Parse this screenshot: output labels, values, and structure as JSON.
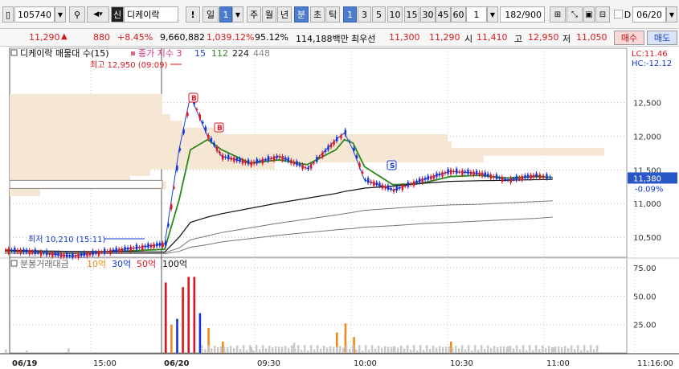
{
  "toolbar": {
    "stock_code": "105740",
    "market_badge": "신",
    "stock_name": "디케이락",
    "period_label": "일",
    "period_value": "1",
    "periods": [
      "주",
      "월",
      "년",
      "분",
      "초",
      "틱"
    ],
    "minute_options": [
      "1",
      "3",
      "5",
      "10",
      "15",
      "30",
      "45",
      "60"
    ],
    "unit_value": "1",
    "count_display": "182/900",
    "date_value": "06/20",
    "exclaim": "!"
  },
  "quote": {
    "price": "11,290",
    "arrow": "▲",
    "change": "880",
    "change_pct": "+8.45%",
    "volume": "9,660,882",
    "volume_ratio": "1,039.12%",
    "strength": "95.12%",
    "amount": "114,188백만",
    "best_label": "최우선",
    "best_ask": "11,300",
    "best_bid": "11,290",
    "open_label": "시",
    "open": "11,410",
    "high_label": "고",
    "high": "12,950",
    "low_label": "저",
    "low": "11,050",
    "buy_label": "매수",
    "sell_label": "매도"
  },
  "chart": {
    "price_panel_title": "디케이락 매물대 수(15)",
    "ma_label": "종가 지수",
    "ma_periods": [
      "3",
      "15",
      "112",
      "224",
      "448"
    ],
    "high_annotation": "최고 12,950 (09:09)",
    "low_annotation": "최저 10,210 (15:11)",
    "lc_label": "LC:11.46",
    "hc_label": "HC:-12.12",
    "current_price_label": "11,380",
    "current_change_label": "-0.09%",
    "signal_b": "B",
    "signal_s": "S",
    "volume_panel_title": "분봉거래대금",
    "volume_levels": [
      "10억",
      "30억",
      "50억",
      "100억"
    ],
    "x_labels": [
      "06/19",
      "15:00",
      "06/20",
      "09:30",
      "10:00",
      "10:30",
      "11:00",
      "11:16:00"
    ],
    "colors": {
      "up": "#e0141e",
      "down": "#1236d6",
      "ma3": "#1e3fd0",
      "ma15": "#2a8a1a",
      "ma112": "#111111",
      "ma224": "#777777",
      "profile": "#f6e6d4",
      "vol_orange": "#f08a1c",
      "vol_gray": "#c8c8c8"
    }
  },
  "chart_data": [
    {
      "type": "line",
      "title": "디케이락 매물대 수(15)",
      "x": [
        "06/19 14:55",
        "06/19 15:00",
        "06/19 15:11",
        "06/20 09:00",
        "06/20 09:05",
        "06/20 09:09",
        "06/20 09:15",
        "06/20 09:20",
        "06/20 09:30",
        "06/20 09:40",
        "06/20 09:50",
        "06/20 10:00",
        "06/20 10:03",
        "06/20 10:06",
        "06/20 10:10",
        "06/20 10:20",
        "06/20 10:30",
        "06/20 10:40",
        "06/20 10:50",
        "06/20 11:00",
        "06/20 11:10",
        "06/20 11:16"
      ],
      "series": [
        {
          "name": "3",
          "values": [
            10310,
            10290,
            10220,
            10400,
            11800,
            12600,
            12000,
            11700,
            11600,
            11700,
            11520,
            11950,
            12050,
            11800,
            11350,
            11200,
            11350,
            11480,
            11450,
            11350,
            11420,
            11380
          ]
        },
        {
          "name": "15",
          "values": [
            10300,
            10295,
            10260,
            10320,
            11050,
            11800,
            11950,
            11800,
            11600,
            11650,
            11580,
            11800,
            11950,
            11900,
            11550,
            11280,
            11300,
            11400,
            11420,
            11380,
            11400,
            11390
          ]
        },
        {
          "name": "112",
          "values": [
            10310,
            10300,
            10290,
            10280,
            10500,
            10720,
            10800,
            10850,
            10930,
            11010,
            11080,
            11150,
            11180,
            11200,
            11230,
            11260,
            11300,
            11330,
            11340,
            11345,
            11355,
            11360
          ]
        },
        {
          "name": "224",
          "values": [
            10280,
            10280,
            10275,
            10270,
            10340,
            10460,
            10520,
            10570,
            10640,
            10710,
            10770,
            10830,
            10850,
            10870,
            10900,
            10930,
            10960,
            10980,
            10990,
            11010,
            11030,
            11040
          ]
        },
        {
          "name": "448",
          "values": [
            10260,
            10260,
            10258,
            10255,
            10290,
            10350,
            10390,
            10430,
            10480,
            10530,
            10570,
            10610,
            10620,
            10630,
            10650,
            10670,
            10700,
            10720,
            10740,
            10760,
            10780,
            10800
          ]
        }
      ],
      "ylim": [
        10250,
        12950
      ],
      "y_ticks": [
        10500,
        11000,
        11500,
        12000,
        12500
      ],
      "high": 12950,
      "low": 10210,
      "current": 11380
    },
    {
      "type": "bar",
      "title": "분봉거래대금",
      "categories": [
        "06/19 14:55",
        "06/19 15:00",
        "06/19 15:10",
        "06/20 09:00",
        "06/20 09:02",
        "06/20 09:04",
        "06/20 09:06",
        "06/20 09:08",
        "06/20 09:10",
        "06/20 09:12",
        "06/20 09:15",
        "06/20 09:20",
        "06/20 09:30",
        "06/20 09:45",
        "06/20 10:00",
        "06/20 10:03",
        "06/20 10:06",
        "06/20 10:20",
        "06/20 10:40",
        "06/20 11:00",
        "06/20 11:16"
      ],
      "values": [
        3,
        2,
        4,
        62,
        25,
        30,
        58,
        67,
        67,
        35,
        22,
        10,
        5,
        9,
        18,
        26,
        14,
        6,
        10,
        6,
        5
      ],
      "ylim": [
        0,
        80
      ],
      "y_ticks": [
        25,
        50,
        75
      ]
    }
  ]
}
